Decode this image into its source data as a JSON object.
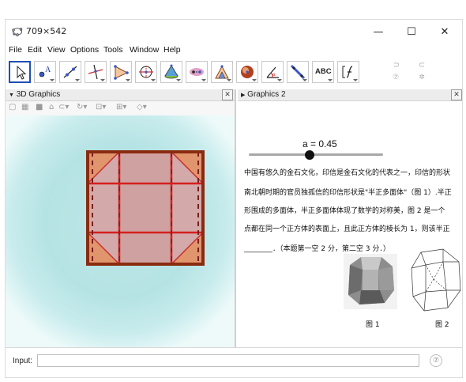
{
  "window": {
    "title": "709×542"
  },
  "controls": {
    "minimize": "—",
    "maximize": "☐",
    "close": "✕"
  },
  "menu": [
    "File",
    "Edit",
    "View",
    "Options",
    "Tools",
    "Window",
    "Help"
  ],
  "toolbar": {
    "tools": [
      "move-tool",
      "point-tool",
      "line-tool",
      "perpendicular-tool",
      "polygon-tool",
      "circle-tool",
      "pyramid-tool",
      "reflect-tool",
      "net-tool",
      "sphere-tool",
      "angle-tool",
      "slide-tool",
      "text-tool",
      "function-tool"
    ],
    "text_tool_label": "ABC",
    "undo": "⊃",
    "redo": "⊂",
    "help": "⑦",
    "settings": "✲"
  },
  "panel3d": {
    "title": "3D Graphics"
  },
  "graphics2": {
    "title": "Graphics 2",
    "slider_label": "a = 0.45",
    "slider_value": 0.45,
    "problem_lines": [
      "中国有悠久的金石文化，印信是金石文化的代表之一，印信的形状",
      "南北朝时期的官员独孤信的印信形状是\"半正多面体\"（图 1）.半正",
      "形围成的多面体，半正多面体体现了数学的对称美，图 2 是一个",
      "点都在同一个正方体的表面上，且此正方体的棱长为 1，则该半正",
      "________．（本题第一空 2 分，第二空 3 分．）"
    ],
    "fig1_caption": "图 1",
    "fig2_caption": "图 2"
  },
  "input": {
    "label": "Input:",
    "value": "",
    "help": "⑦"
  }
}
